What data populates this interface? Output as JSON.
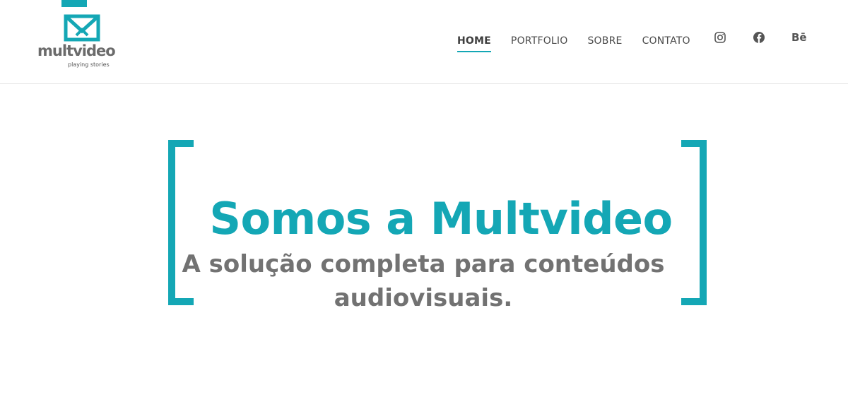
{
  "brand": {
    "name": "multvideo",
    "tagline": "playing stories",
    "accent_color": "#14a7b5",
    "text_color": "#6b6b6b"
  },
  "nav": {
    "items": [
      {
        "label": "HOME",
        "active": true
      },
      {
        "label": "PORTFOLIO",
        "active": false
      },
      {
        "label": "SOBRE",
        "active": false
      },
      {
        "label": "CONTATO",
        "active": false
      }
    ],
    "social": [
      {
        "icon": "instagram-icon"
      },
      {
        "icon": "facebook-icon"
      },
      {
        "icon": "behance-icon",
        "label": "Bē"
      }
    ]
  },
  "hero": {
    "title": "Somos a Multvideo",
    "subtitle": "A solução completa para conteúdos audiovisuais."
  }
}
